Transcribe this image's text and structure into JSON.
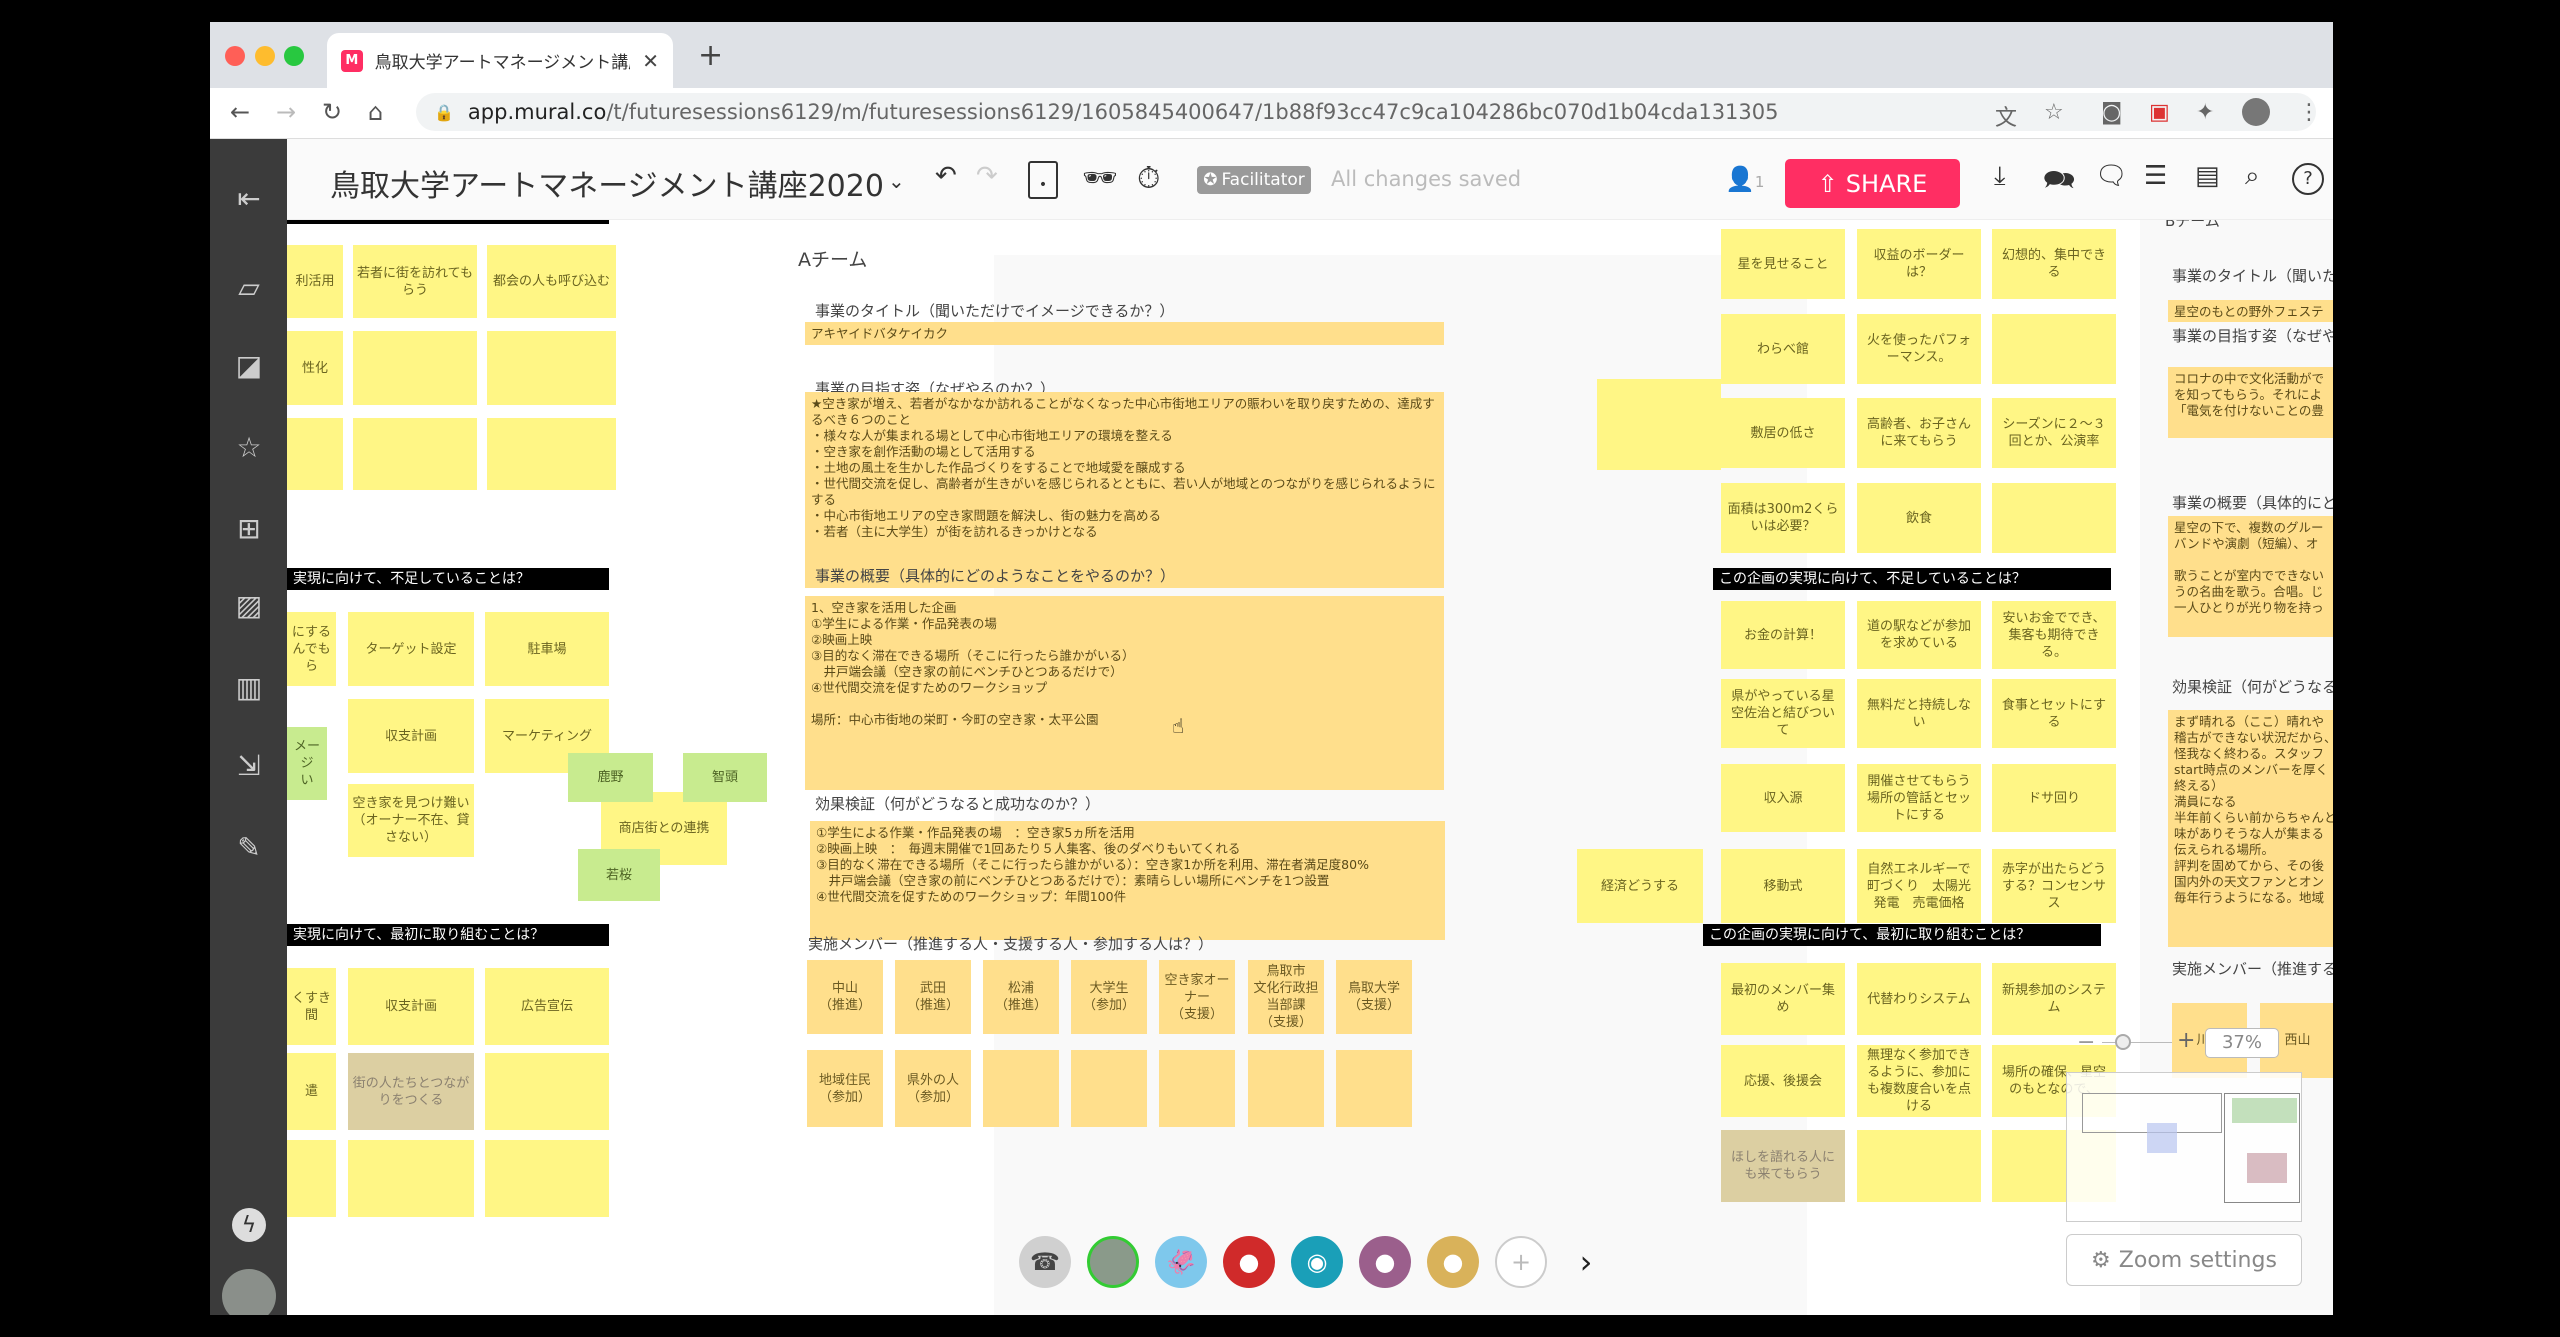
{
  "browser": {
    "tab_title": "鳥取大学アートマネージメント講座2020",
    "tab_favicon": "mural-logo-icon",
    "url_host": "app.mural.co",
    "url_path": "/t/futuresessions6129/m/futuresessions6129/1605845400647/1b88f93cc47c9ca104286bc070d1b04cda131305"
  },
  "toolbar": {
    "mural_title": "鳥取大学アートマネージメント講座2020",
    "facilitator": "Facilitator",
    "status": "All changes saved",
    "user_count": "1",
    "share": "SHARE",
    "share_color": "#ff2e63"
  },
  "left_group": {
    "header_missing": "実現に向けて、不足していることは？",
    "header_first": "実現に向けて、最初に取り組むことは？",
    "stickies": [
      "利活用",
      "若者に街を訪れてもらう",
      "都会の人も呼び込む",
      "性化",
      "",
      "",
      "",
      "",
      "",
      "にする\nんでもら",
      "ターゲット設定",
      "駐車場",
      "収支計画",
      "マーケティング",
      "空き家を見つけ難い（オーナー不在、貸さない）",
      "メージ\nい",
      "商店街との連携",
      "鹿野",
      "智頭",
      "若桜",
      "くすき間",
      "収支計画",
      "広告宣伝",
      "遣",
      "街の人たちとつながりをつくる",
      "",
      "",
      "",
      ""
    ]
  },
  "team_a": {
    "title": "Aチーム",
    "title_label": "事業のタイトル（聞いただけでイメージできるか？）",
    "title_value": "アキヤイドバタケイカク",
    "vision_label": "事業の目指す姿（なぜやるのか？）",
    "vision_value": "★空き家が増え、若者がなかなか訪れることがなくなった中心市街地エリアの賑わいを取り戻すための、達成するべき６つのこと\n・様々な人が集まれる場として中心市街地エリアの環境を整える\n・空き家を創作活動の場として活用する\n・土地の風土を生かした作品づくりをすることで地域愛を醸成する\n・世代間交流を促し、高齢者が生きがいを感じられるとともに、若い人が地域とのつながりを感じられるようにする\n・中心市街地エリアの空き家問題を解決し、街の魅力を高める\n・若者（主に大学生）が街を訪れるきっかけとなる",
    "overview_label": "事業の概要（具体的にどのようなことをやるのか？）",
    "overview_value": "1、空き家を活用した企画\n①学生による作業・作品発表の場\n②映画上映\n③目的なく滞在できる場所（そこに行ったら誰かがいる）\n　井戸端会議（空き家の前にベンチひとつあるだけで）\n④世代間交流を促すためのワークショップ\n\n場所：中心市街地の栄町・今町の空き家・太平公園",
    "effect_label": "効果検証（何がどうなると成功なのか？）",
    "effect_value": "①学生による作業・作品発表の場　：空き家5ヵ所を活用\n②映画上映　：　毎週末開催で1回あたり５人集客、後のダベりもいてくれる\n③目的なく滞在できる場所（そこに行ったら誰かがいる）：空き家1か所を利用、滞在者満足度80%\n　井戸端会議（空き家の前にベンチひとつあるだけで）：素晴らしい場所にベンチを1つ設置\n④世代間交流を促すためのワークショップ：年間100件",
    "members_label": "実施メンバー（推進する人・支援する人・参加する人は？）",
    "members": [
      "中山\n（推進）",
      "武田\n（推進）",
      "松浦\n（推進）",
      "大学生\n（参加）",
      "空き家オーナー\n（支援）",
      "鳥取市\n文化行政担当部課\n（支援）",
      "鳥取大学\n（支援）",
      "地域住民\n（参加）",
      "県外の人\n（参加）",
      "",
      "",
      "",
      "",
      ""
    ]
  },
  "b_group": {
    "header_missing": "この企画の実現に向けて、不足していることは？",
    "header_first": "この企画の実現に向けて、最初に取り組むことは？",
    "ideas": [
      "星を見せること",
      "収益のボーダーは？",
      "幻想的、集中できる",
      "わらべ館",
      "火を使ったパフォーマンス。",
      "",
      "敷居の低さ",
      "高齢者、お子さんに来てもらう",
      "シーズンに２〜３回とか、公演率",
      "面積は300m2くらいは必要？",
      "飲食",
      ""
    ],
    "missing": [
      "お金の計算！",
      "道の駅などが参加を求めている",
      "安いお金ででき、集客も期待できる。",
      "県がやっている星空佐治と結びついて",
      "無料だと持続しない",
      "食事とセットにする",
      "収入源",
      "開催させてもらう場所の管話とセットにする",
      "ドサ回り",
      "経済どうする",
      "移動式",
      "自然エネルギーで町づくり　太陽光発電　売電価格",
      "赤字が出たらどうする？コンセンサス"
    ],
    "first": [
      "最初のメンバー集め",
      "代替わりシステム",
      "新規参加のシステム",
      "応援、後援会",
      "無理なく参加できるように、参加にも複数度合いを点ける",
      "場所の確保、星空のもとなので、",
      "ほしを語れる人にも来てもらう",
      "",
      ""
    ]
  },
  "team_b": {
    "title": "Bチーム",
    "title_label": "事業のタイトル（聞いた",
    "title_value": "星空のもとの野外フェステ",
    "vision_label": "事業の目指す姿（なぜや",
    "vision_value": "コロナの中で文化活動がで\nを知ってもらう。それによ\n「電気を付けないことの豊",
    "overview_label": "事業の概要（具体的にど",
    "overview_value": "星空の下で、複数のグルー\nバンドや演劇（短編）、オ\n\n歌うことが室内でできない\nうの名曲を歌う。合唱。じ\n一人ひとりが光り物を持っ",
    "effect_label": "効果検証（何がどうなる",
    "effect_value": "まず晴れる（ここ）晴れや\n稽古ができない状況だから、\n怪我なく終わる。スタッフ\nstart時点のメンバーを厚く\n終える）\n満員になる\n半年前くらい前からちゃんと\n味がありそうな人が集まる\n伝えられる場所。\n評判を固めてから、その後\n国内外の天文ファンとオン\n毎年行うようになる。地域",
    "members_label": "実施メンバー（推進する",
    "members": [
      "川口",
      "西山"
    ]
  },
  "zoom": {
    "level": "37%",
    "settings": "Zoom settings"
  },
  "avatars": [
    {
      "name": "phone-icon",
      "color": "#d0d0d0"
    },
    {
      "name": "user-photo-avatar",
      "color": "#8a9a8a"
    },
    {
      "name": "squid-avatar",
      "color": "#7ec8ec"
    },
    {
      "name": "platypus-avatar",
      "color": "#d02a2a"
    },
    {
      "name": "owl-avatar",
      "color": "#1a9fb8"
    },
    {
      "name": "hippo-avatar",
      "color": "#9b5f8c"
    },
    {
      "name": "rhino-avatar",
      "color": "#d9b25a"
    }
  ],
  "colors": {
    "sticky_yellow": "#fff685",
    "sticky_green": "#c8eb8f",
    "sticky_orange": "#ffdf8c",
    "sidebar": "#3b3b3b"
  }
}
